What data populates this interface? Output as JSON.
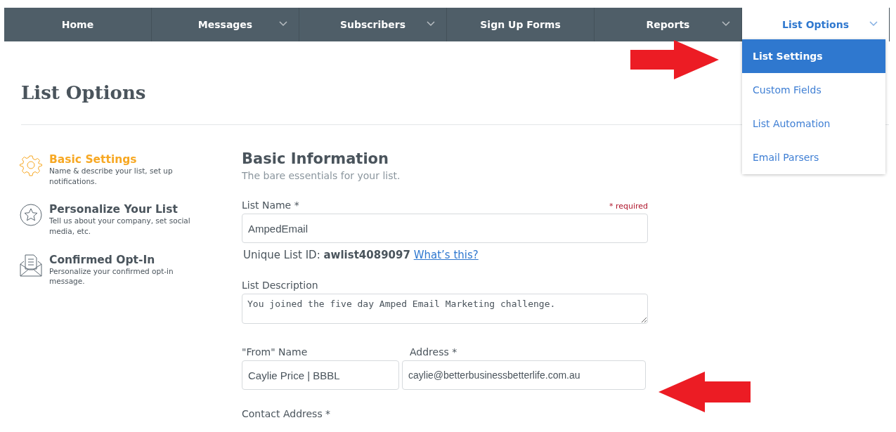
{
  "nav": {
    "items": [
      {
        "label": "Home",
        "has_menu": false,
        "selected": false
      },
      {
        "label": "Messages",
        "has_menu": true,
        "selected": false
      },
      {
        "label": "Subscribers",
        "has_menu": true,
        "selected": false
      },
      {
        "label": "Sign Up Forms",
        "has_menu": false,
        "selected": false
      },
      {
        "label": "Reports",
        "has_menu": true,
        "selected": false
      },
      {
        "label": "List Options",
        "has_menu": true,
        "selected": true
      }
    ]
  },
  "dropdown": {
    "items": [
      {
        "label": "List Settings",
        "selected": true
      },
      {
        "label": "Custom Fields",
        "selected": false
      },
      {
        "label": "List Automation",
        "selected": false
      },
      {
        "label": "Email Parsers",
        "selected": false
      }
    ]
  },
  "page_title": "List Options",
  "sidebar": {
    "items": [
      {
        "kind": "gear",
        "title": "Basic Settings",
        "description": "Name & describe your list, set up notifications.",
        "selected": true
      },
      {
        "kind": "star",
        "title": "Personalize Your List",
        "description": "Tell us about your company, set social media, etc.",
        "selected": false
      },
      {
        "kind": "envelope",
        "title": "Confirmed Opt-In",
        "description": "Personalize your confirmed opt-in message.",
        "selected": false
      }
    ]
  },
  "section": {
    "title": "Basic Information",
    "subtitle": "The bare essentials for your list.",
    "required_note": "* required",
    "list_name": {
      "label": "List Name *",
      "value": "AmpedEmail"
    },
    "unique_id": "Unique List ID: **awlist4089097**",
    "help_link": "What’s this?",
    "list_description": {
      "label": "List Description",
      "value": "You joined the five day Amped Email Marketing challenge."
    },
    "from_name": {
      "label": "\"From\" Name",
      "value": "Caylie Price | BBBL"
    },
    "from_address": {
      "label": "Address *",
      "value": "caylie@betterbusinessbetterlife.com.au"
    },
    "contact_address": {
      "label": "Contact Address *"
    }
  }
}
